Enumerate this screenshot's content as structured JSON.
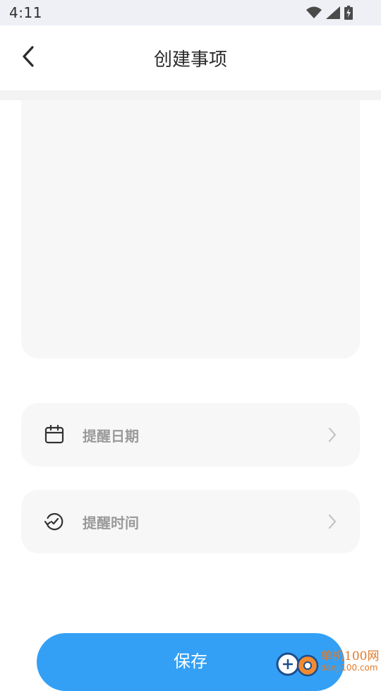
{
  "status_bar": {
    "time": "4:11"
  },
  "header": {
    "title": "创建事项"
  },
  "content": {
    "text": ""
  },
  "rows": {
    "date": {
      "label": "提醒日期",
      "icon": "calendar-icon"
    },
    "time": {
      "label": "提醒时间",
      "icon": "clock-icon"
    }
  },
  "save_button": {
    "label": "保存"
  },
  "watermark": {
    "cn": "单机100网",
    "url": "danji100.com"
  },
  "colors": {
    "accent": "#33a0f5",
    "card_bg": "#f7f7f7",
    "status_bg": "#eef0f6",
    "muted_text": "#9a9a9a"
  }
}
